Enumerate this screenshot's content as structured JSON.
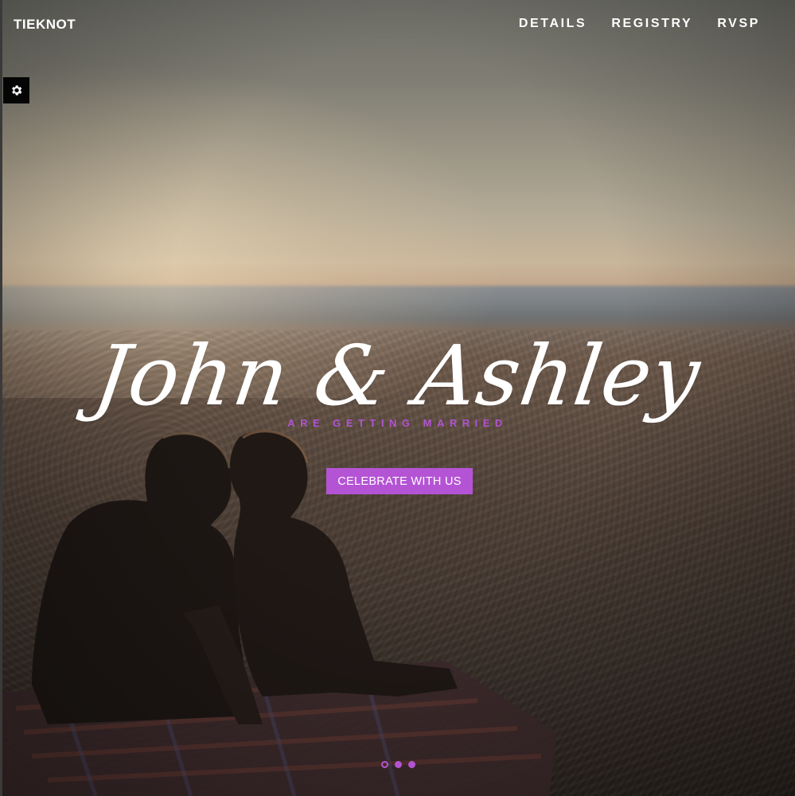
{
  "brand": "TIEKNOT",
  "nav": {
    "items": [
      "DETAILS",
      "REGISTRY",
      "RVSP"
    ]
  },
  "settings": {
    "icon": "gear-icon"
  },
  "hero": {
    "names": "John & Ashley",
    "tagline": "ARE GETTING MARRIED",
    "cta_label": "CELEBRATE WITH US"
  },
  "slider": {
    "count": 3,
    "active_index": 0
  },
  "colors": {
    "accent": "#b454d4",
    "text": "#ffffff",
    "settings_bg": "#050505"
  }
}
